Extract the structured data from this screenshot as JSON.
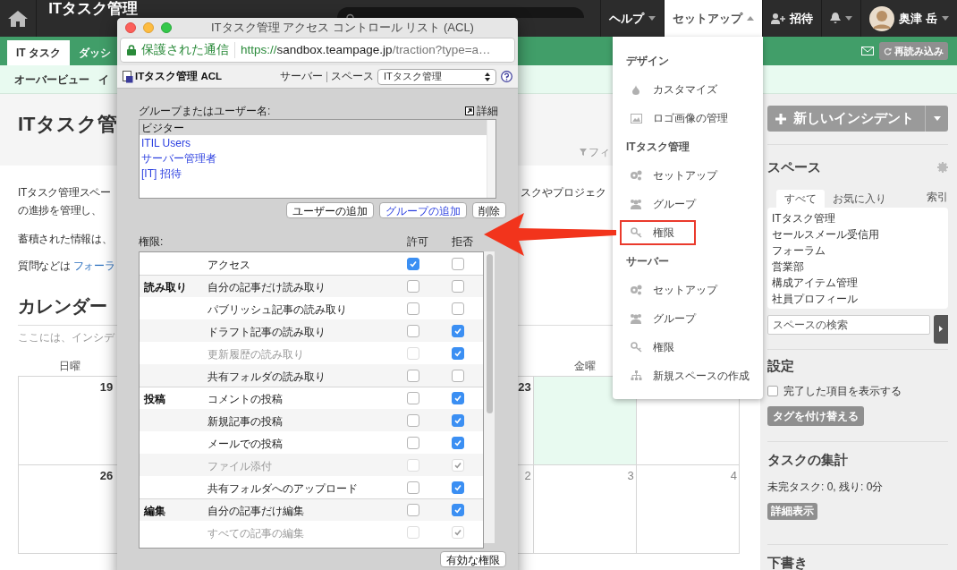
{
  "topbar": {
    "title": "ITタスク管理",
    "menus": [
      {
        "kind": "menu",
        "label": "ヘルプ",
        "open": false
      },
      {
        "kind": "menu",
        "label": "セットアップ",
        "open": true
      },
      {
        "kind": "invite",
        "label": "招待"
      },
      {
        "kind": "bell"
      },
      {
        "kind": "user",
        "label": "奥津 岳"
      }
    ]
  },
  "tabs": [
    {
      "label": "IT タスク",
      "selected": true
    },
    {
      "label": "ダッシ",
      "selected": false
    }
  ],
  "reload_button": "再読み込み",
  "subnav": [
    "オーバービュー",
    "イ"
  ],
  "page": {
    "title": "ITタスク管",
    "filter": "フィ",
    "lines": [
      {
        "left": "ITタスク管理スペー",
        "right": "スクやプロジェク"
      },
      {
        "left": "の進捗を管理し、"
      },
      {
        "left": "蓄積された情報は、"
      },
      {
        "left": "質問などは",
        "link": "フォーラ"
      }
    ],
    "calendar": {
      "title": "カレンダー",
      "note": "ここには、インシデ",
      "weekdays": {
        "sun": "日曜",
        "fri": "金曜"
      },
      "weeks": [
        {
          "sun": {
            "day": "19",
            "today": false
          },
          "thu": {
            "day": "23",
            "today": false
          },
          "fri": {
            "today": true
          },
          "sat": {
            "today": false
          }
        },
        {
          "sun": {
            "day": "26",
            "today": false
          },
          "thu": {
            "day": "2",
            "today": false
          },
          "fri": {
            "day": "3",
            "today": false
          },
          "sat": {
            "day": "4",
            "today": false
          }
        }
      ]
    }
  },
  "sidebar": {
    "new_button": "新しいインシデント",
    "spaces_title": "スペース",
    "space_tabs": [
      {
        "label": "すべて",
        "selected": true
      },
      {
        "label": "お気に入り",
        "selected": false
      }
    ],
    "index_link": "索引",
    "spaces": [
      "ITタスク管理",
      "セールスメール受信用",
      "フォーラム",
      "営業部",
      "構成アイテム管理",
      "社員プロフィール"
    ],
    "space_search": {
      "placeholder": "スペースの検索"
    },
    "settings_title": "設定",
    "show_done": {
      "label": "完了した項目を表示する",
      "checked": false
    },
    "retag_button": "タグを付け替える",
    "summary_title": "タスクの集計",
    "summary": "未完タスク: 0, 残り: 0分",
    "detail_button": "詳細表示",
    "drafts_title": "下書き"
  },
  "dropdown": [
    {
      "header": "デザイン",
      "items": [
        {
          "kind": "customize",
          "label": "カスタマイズ",
          "highlighted": false
        },
        {
          "kind": "image",
          "label": "ロゴ画像の管理",
          "highlighted": false
        }
      ]
    },
    {
      "header": "ITタスク管理",
      "items": [
        {
          "kind": "setup",
          "label": "セットアップ",
          "highlighted": false
        },
        {
          "kind": "group",
          "label": "グループ",
          "highlighted": false
        },
        {
          "kind": "permission",
          "label": "権限",
          "highlighted": true
        }
      ]
    },
    {
      "header": "サーバー",
      "items": [
        {
          "kind": "setup",
          "label": "セットアップ",
          "highlighted": false
        },
        {
          "kind": "group",
          "label": "グループ",
          "highlighted": false
        },
        {
          "kind": "permission",
          "label": "権限",
          "highlighted": false
        },
        {
          "kind": "new-space",
          "label": "新規スペースの作成",
          "highlighted": false
        }
      ]
    }
  ],
  "acl_window": {
    "title": "ITタスク管理 アクセス コントロール リスト (ACL)",
    "secure": "保護された通信",
    "url_scheme": "https://",
    "url_host": "sandbox.teampage.jp",
    "url_path": "/traction?type=a…",
    "heading": "ITタスク管理 ACL",
    "server_link": "サーバー",
    "space_label": "スペース",
    "space_select": "ITタスク管理",
    "principals_label": "グループまたはユーザー名:",
    "detail_link": "詳細",
    "principals": [
      {
        "label": "ビジター",
        "selected": true,
        "kind": "user"
      },
      {
        "label": "ITIL Users",
        "selected": false,
        "kind": "group"
      },
      {
        "label": "サーバー管理者",
        "selected": false,
        "kind": "group"
      },
      {
        "label": "[IT] 招待",
        "selected": false,
        "kind": "group"
      }
    ],
    "buttons": [
      {
        "label": "ユーザーの追加",
        "kind": "user"
      },
      {
        "label": "グループの追加",
        "kind": "group"
      },
      {
        "label": "削除",
        "kind": "user"
      }
    ],
    "permissions_label": "権限:",
    "allow_header": "許可",
    "deny_header": "拒否",
    "permissions": [
      {
        "label": "アクセス",
        "allow": true,
        "deny": false,
        "disabled": false,
        "deny_disabled": false
      },
      {
        "group": "読み取り",
        "label": "自分の記事だけ読み取り",
        "allow": false,
        "deny": false,
        "disabled": false,
        "deny_disabled": false
      },
      {
        "label": "パブリッシュ記事の読み取り",
        "allow": false,
        "deny": false,
        "disabled": false,
        "deny_disabled": false
      },
      {
        "label": "ドラフト記事の読み取り",
        "allow": false,
        "deny": true,
        "disabled": false,
        "deny_disabled": false
      },
      {
        "label": "更新履歴の読み取り",
        "allow": false,
        "deny": true,
        "disabled": true,
        "deny_disabled": false
      },
      {
        "label": "共有フォルダの読み取り",
        "allow": false,
        "deny": false,
        "disabled": false,
        "deny_disabled": false
      },
      {
        "group": "投稿",
        "label": "コメントの投稿",
        "allow": false,
        "deny": true,
        "disabled": false,
        "deny_disabled": false
      },
      {
        "label": "新規記事の投稿",
        "allow": false,
        "deny": true,
        "disabled": false,
        "deny_disabled": false
      },
      {
        "label": "メールでの投稿",
        "allow": false,
        "deny": true,
        "disabled": false,
        "deny_disabled": false
      },
      {
        "label": "ファイル添付",
        "allow": false,
        "deny": true,
        "disabled": true,
        "deny_disabled": true
      },
      {
        "label": "共有フォルダへのアップロード",
        "allow": false,
        "deny": true,
        "disabled": false,
        "deny_disabled": false
      },
      {
        "group": "編集",
        "label": "自分の記事だけ編集",
        "allow": false,
        "deny": true,
        "disabled": false,
        "deny_disabled": false
      },
      {
        "label": "すべての記事の編集",
        "allow": false,
        "deny": true,
        "disabled": true,
        "deny_disabled": true
      }
    ],
    "effective_button": "有効な権限"
  }
}
